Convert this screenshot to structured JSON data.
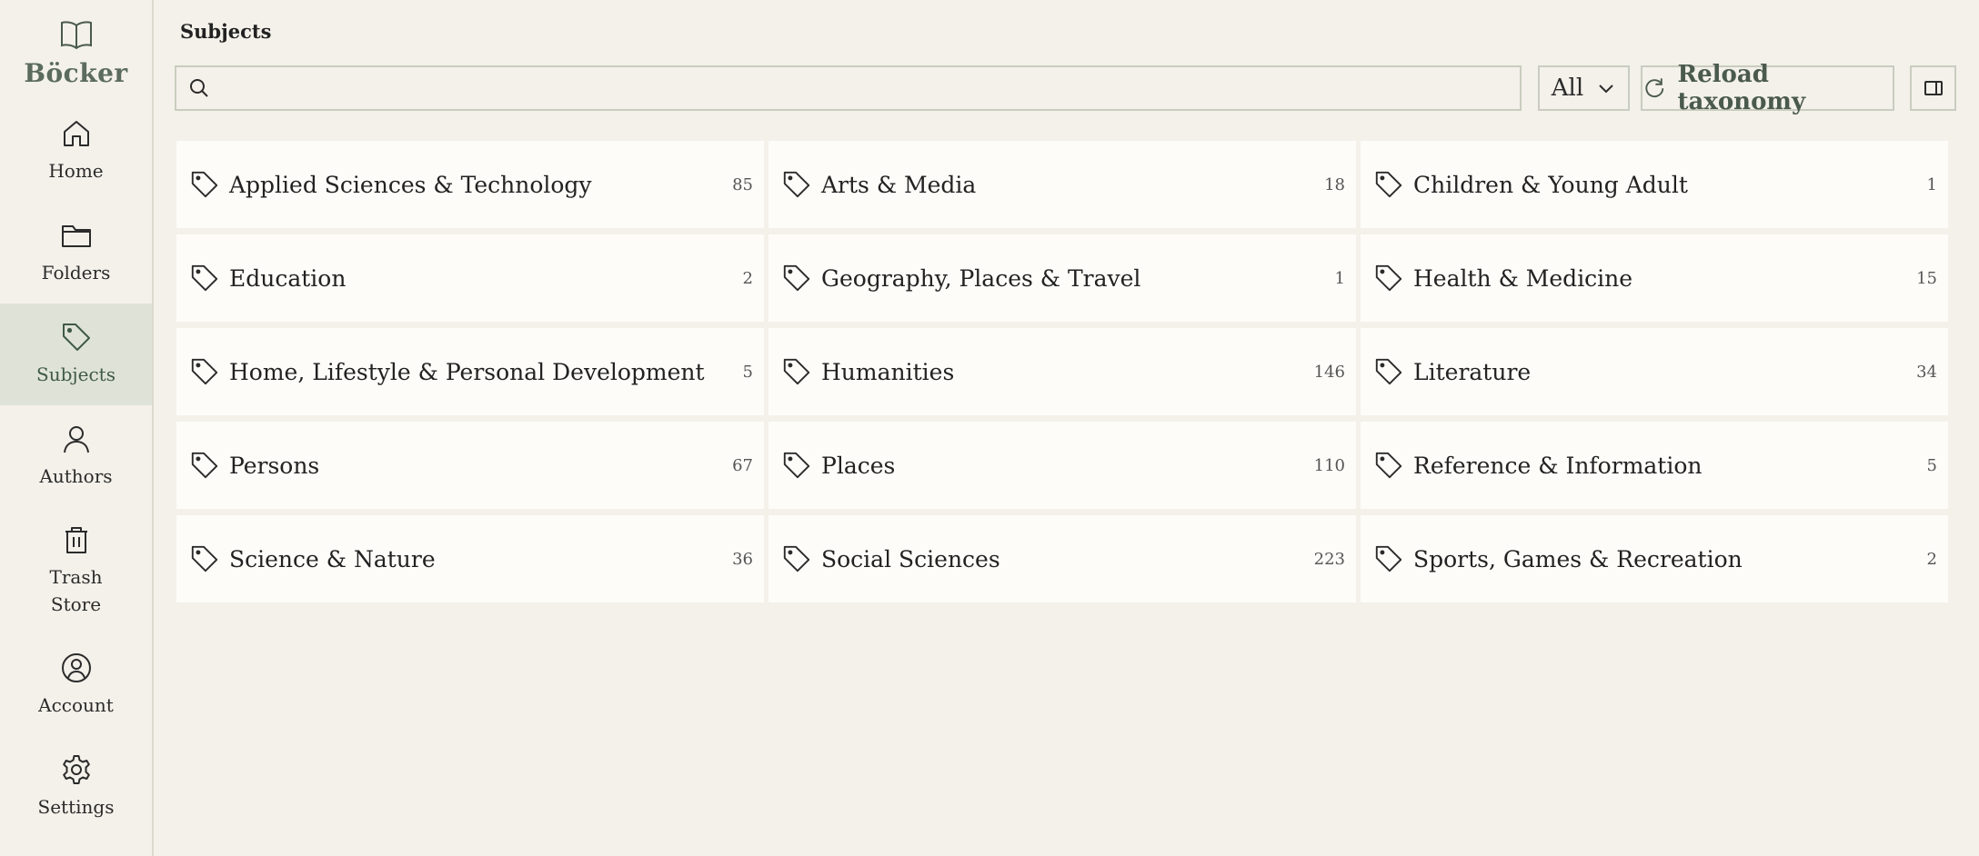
{
  "brand": {
    "name": "Böcker"
  },
  "sidebar": {
    "items": [
      {
        "key": "home",
        "label": "Home"
      },
      {
        "key": "folders",
        "label": "Folders"
      },
      {
        "key": "subjects",
        "label": "Subjects",
        "active": true
      },
      {
        "key": "authors",
        "label": "Authors"
      },
      {
        "key": "trash",
        "label": "Trash Store"
      },
      {
        "key": "account",
        "label": "Account"
      },
      {
        "key": "settings",
        "label": "Settings"
      }
    ]
  },
  "header": {
    "title": "Subjects"
  },
  "toolbar": {
    "search_placeholder": "",
    "search_value": "",
    "filter_value": "All",
    "reload_label": "Reload taxonomy"
  },
  "subjects": [
    {
      "label": "Applied Sciences & Technology",
      "count": "85"
    },
    {
      "label": "Arts & Media",
      "count": "18"
    },
    {
      "label": "Children & Young Adult",
      "count": "1"
    },
    {
      "label": "Education",
      "count": "2"
    },
    {
      "label": "Geography, Places & Travel",
      "count": "1"
    },
    {
      "label": "Health & Medicine",
      "count": "15"
    },
    {
      "label": "Home, Lifestyle & Personal Development",
      "count": "5"
    },
    {
      "label": "Humanities",
      "count": "146"
    },
    {
      "label": "Literature",
      "count": "34"
    },
    {
      "label": "Persons",
      "count": "67"
    },
    {
      "label": "Places",
      "count": "110"
    },
    {
      "label": "Reference & Information",
      "count": "5"
    },
    {
      "label": "Science & Nature",
      "count": "36"
    },
    {
      "label": "Social Sciences",
      "count": "223"
    },
    {
      "label": "Sports, Games & Recreation",
      "count": "2"
    }
  ],
  "colors": {
    "accent": "#4a5a4d",
    "active_bg": "#dfe3d7",
    "background": "#f3f1ea",
    "card": "#fdfcf8"
  }
}
